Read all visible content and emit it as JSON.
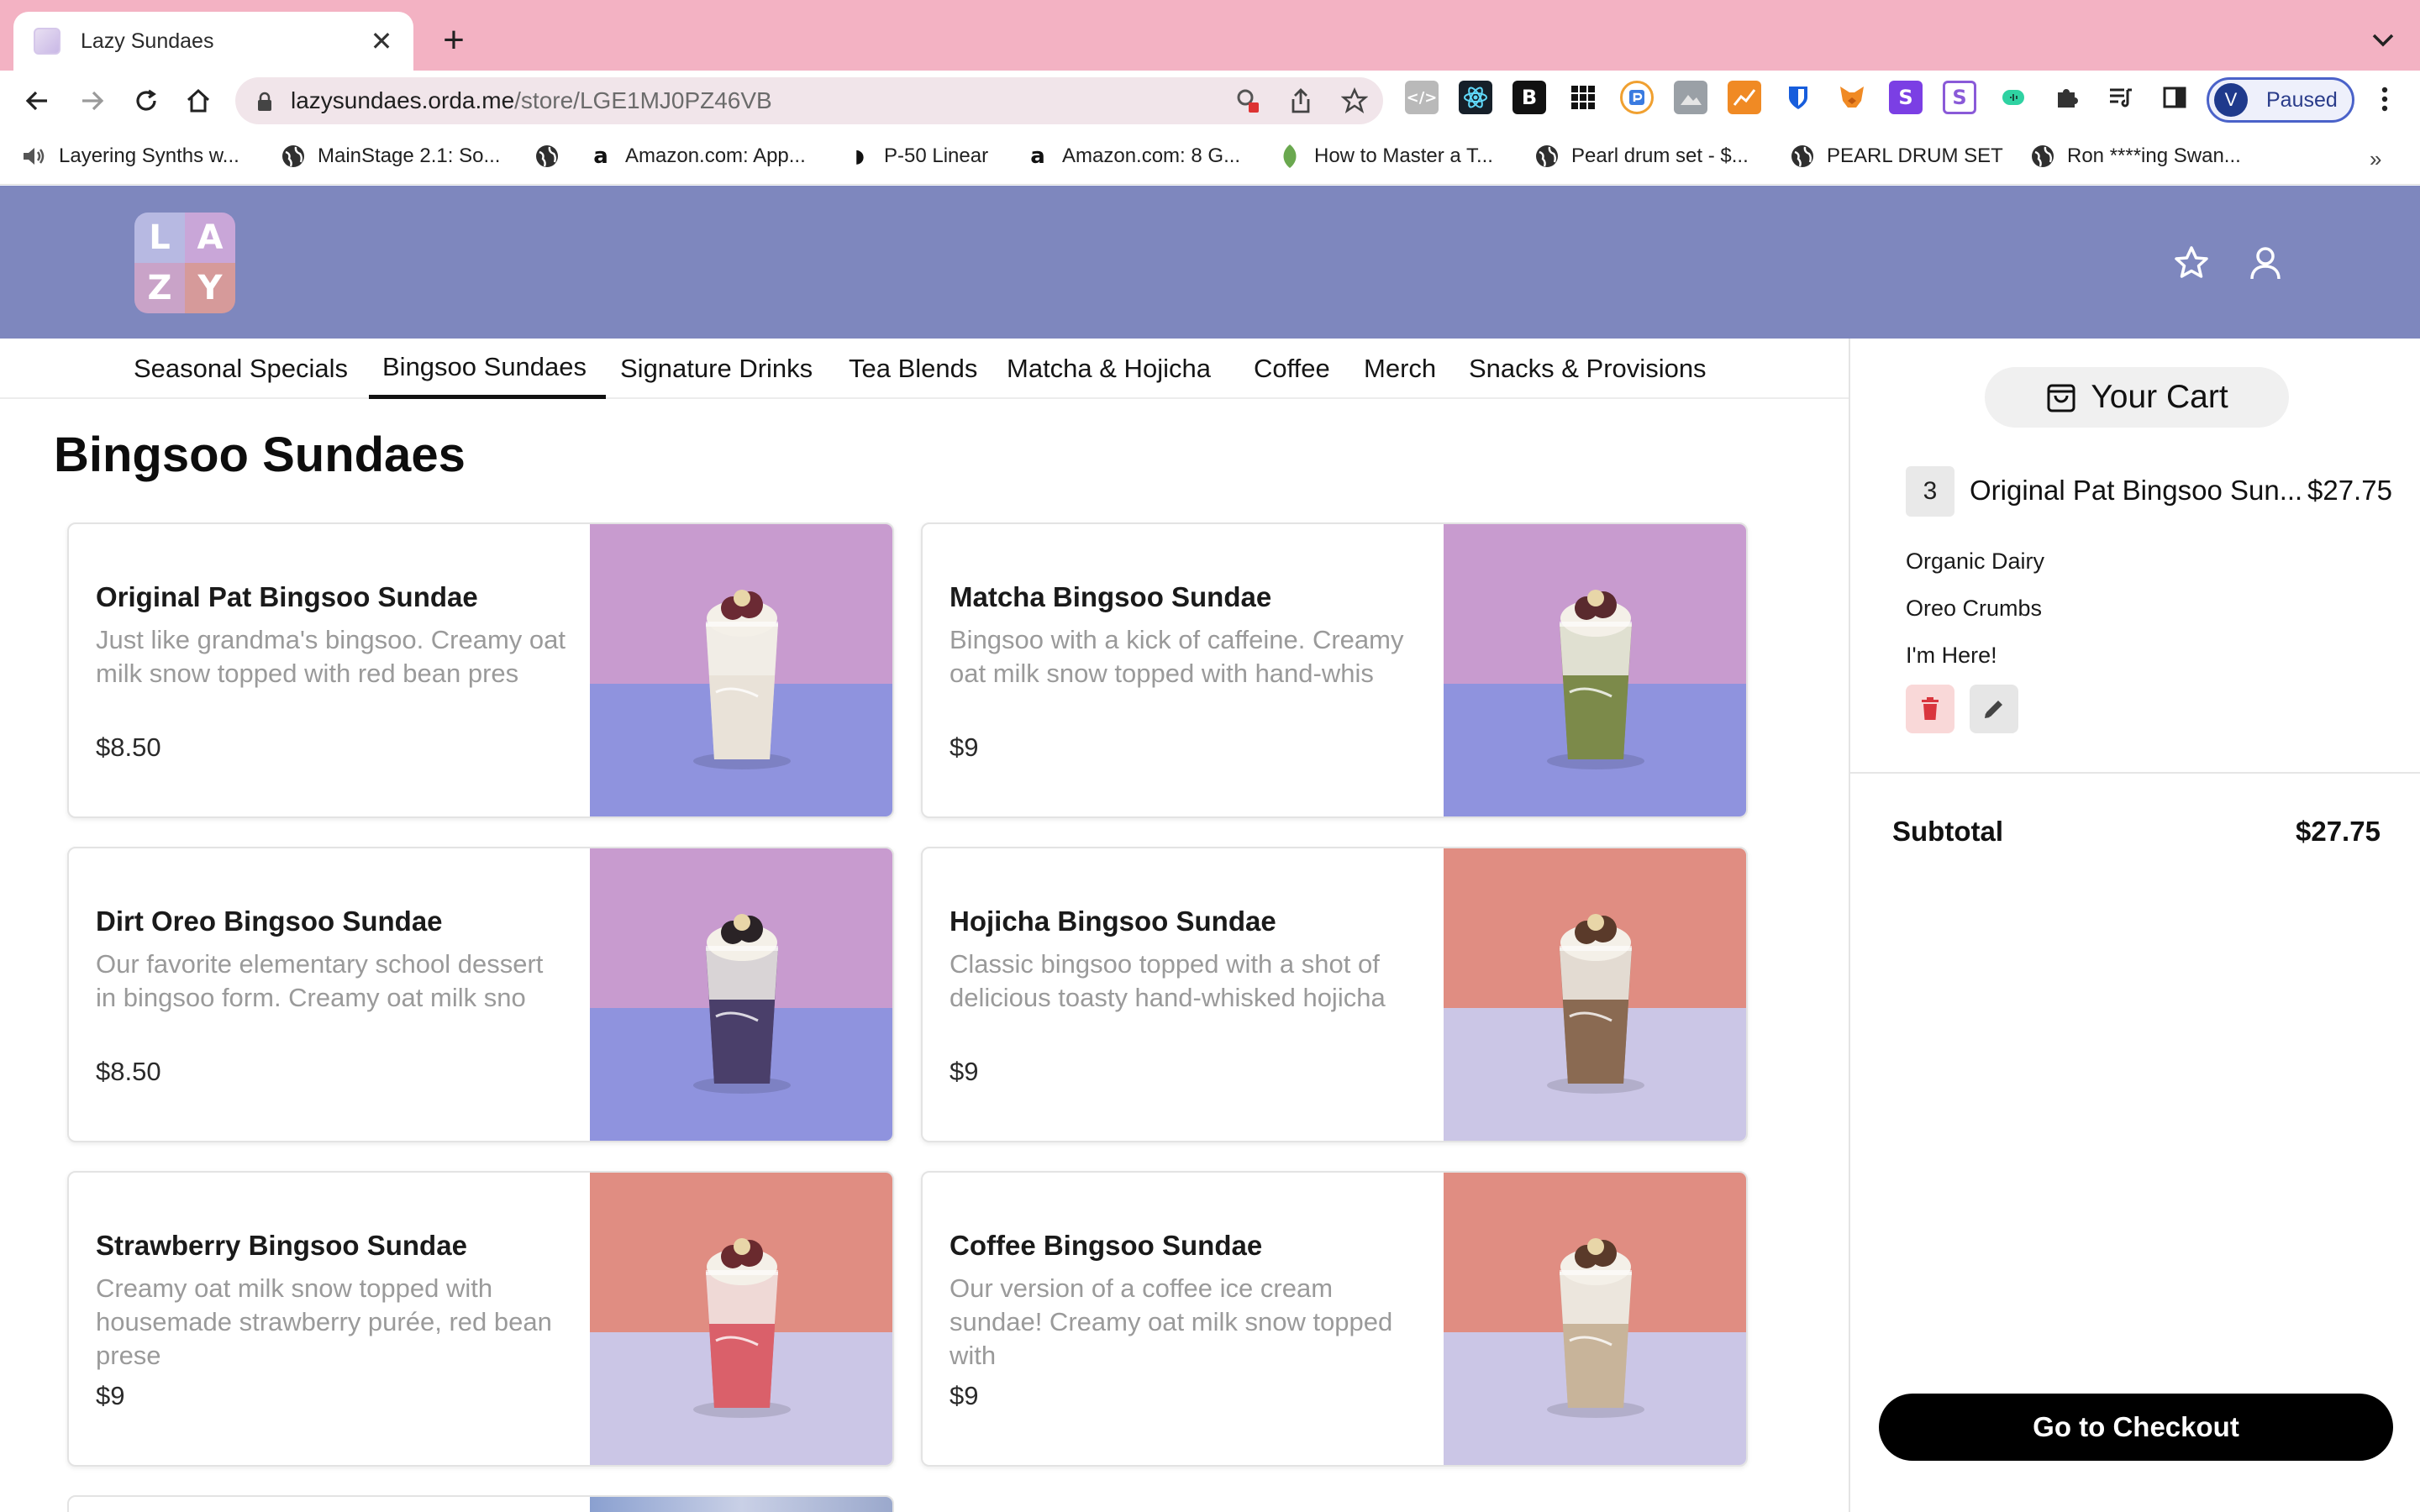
{
  "browser": {
    "tab_title": "Lazy Sundaes",
    "url_host": "lazysundaes.orda.me",
    "url_path": "/store/LGE1MJ0PZ46VB",
    "profile_initial": "V",
    "profile_status": "Paused",
    "bookmarks": [
      {
        "label": "Layering Synths w...",
        "icon": "speaker-icon"
      },
      {
        "label": "MainStage 2.1: So...",
        "icon": "globe-icon"
      },
      {
        "label": "",
        "icon": "globe-icon"
      },
      {
        "label": "Amazon.com: App...",
        "icon": "amazon-icon"
      },
      {
        "label": "P-50 Linear",
        "icon": "p-logo-icon"
      },
      {
        "label": "Amazon.com: 8 G...",
        "icon": "amazon-icon"
      },
      {
        "label": "How to Master a T...",
        "icon": "leaf-icon"
      },
      {
        "label": "Pearl drum set - $...",
        "icon": "globe-icon"
      },
      {
        "label": "PEARL DRUM SET",
        "icon": "globe-icon"
      },
      {
        "label": "Ron ****ing Swan...",
        "icon": "globe-icon"
      }
    ]
  },
  "header": {
    "logo_letters": [
      "L",
      "A",
      "Z",
      "Y"
    ]
  },
  "categories": [
    "Seasonal Specials",
    "Bingsoo Sundaes",
    "Signature Drinks",
    "Tea Blends",
    "Matcha & Hojicha",
    "Coffee",
    "Merch",
    "Snacks & Provisions"
  ],
  "active_category": "Bingsoo Sundaes",
  "page_title": "Bingsoo Sundaes",
  "products": [
    {
      "name": "Original Pat Bingsoo Sundae",
      "description": "Just like grandma's bingsoo. Creamy oat milk snow topped with red bean pres",
      "price": "$8.50",
      "backdrop": "purple",
      "topping": "#6b2a34",
      "base": "#e9e2d8"
    },
    {
      "name": "Matcha Bingsoo Sundae",
      "description": "Bingsoo with a kick of caffeine. Creamy oat milk snow topped with hand-whis",
      "price": "$9",
      "backdrop": "purple",
      "topping": "#5a2a2e",
      "base": "#7c8a4a"
    },
    {
      "name": "Dirt Oreo Bingsoo Sundae",
      "description": "Our favorite elementary school dessert in bingsoo form. Creamy oat milk sno",
      "price": "$8.50",
      "backdrop": "purple",
      "topping": "#2a2326",
      "base": "#4a3f6a"
    },
    {
      "name": "Hojicha Bingsoo Sundae",
      "description": "Classic bingsoo topped with a shot of delicious toasty hand-whisked hojicha",
      "price": "$9",
      "backdrop": "salmon",
      "topping": "#5a3a2a",
      "base": "#8a6a52"
    },
    {
      "name": "Strawberry Bingsoo Sundae",
      "description": "Creamy oat milk snow topped with housemade strawberry purée, red bean prese",
      "price": "$9",
      "backdrop": "salmon",
      "topping": "#6a2a2e",
      "base": "#d9606a"
    },
    {
      "name": "Coffee Bingsoo Sundae",
      "description": "Our version of a coffee ice cream sundae! Creamy oat milk snow topped with",
      "price": "$9",
      "backdrop": "salmon",
      "topping": "#5a3a2a",
      "base": "#c8b49a"
    }
  ],
  "cart": {
    "title": "Your Cart",
    "item": {
      "quantity": "3",
      "name": "Original Pat Bingsoo Sun...",
      "price": "$27.75"
    },
    "modifiers": [
      "Organic Dairy",
      "Oreo Crumbs",
      "I'm Here!"
    ],
    "subtotal_label": "Subtotal",
    "subtotal_value": "$27.75",
    "checkout_label": "Go to Checkout"
  },
  "colors": {
    "tabbar": "#f3b2c3",
    "header": "#7e87be",
    "logo_tiles": [
      "#b7b9e2",
      "#c9a6d8",
      "#c9a3c8",
      "#d69a9a"
    ],
    "backdrop_purple_top": "#c89bcf",
    "backdrop_purple_floor": "#8f93de",
    "backdrop_salmon_top": "#e08d82",
    "backdrop_salmon_floor": "#cbc6e6",
    "delete_button": "#f9d8d8",
    "edit_button": "#e6e6e6"
  }
}
